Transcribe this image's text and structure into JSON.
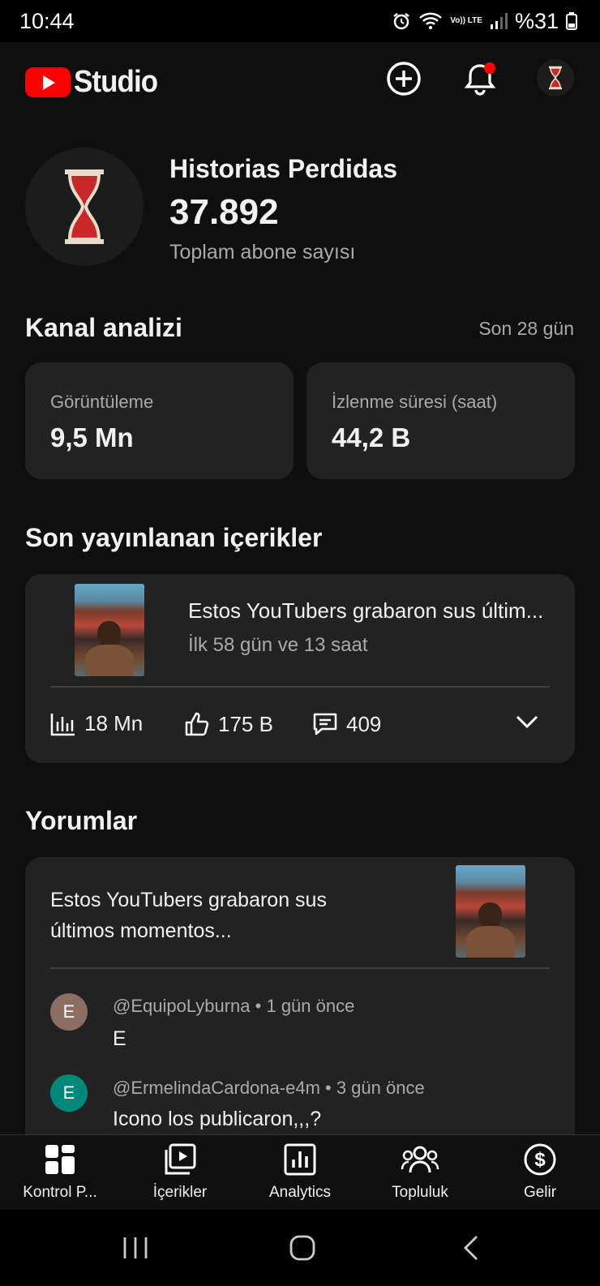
{
  "status_bar": {
    "time": "10:44",
    "network_label": "Vo)) LTE",
    "battery": "%31"
  },
  "app": {
    "logo_text": "Studio"
  },
  "channel": {
    "name": "Historias Perdidas",
    "subscribers": "37.892",
    "subscribers_label": "Toplam abone sayısı"
  },
  "analytics": {
    "title": "Kanal analizi",
    "period": "Son 28 gün",
    "cards": [
      {
        "label": "Görüntüleme",
        "value": "9,5 Mn"
      },
      {
        "label": "İzlenme süresi (saat)",
        "value": "44,2 B"
      }
    ]
  },
  "recent": {
    "title": "Son yayınlanan içerikler",
    "video_title": "Estos YouTubers grabaron sus últim...",
    "age": "İlk 58 gün ve 13 saat",
    "views": "18 Mn",
    "likes": "175 B",
    "comments": "409"
  },
  "comments_section": {
    "title": "Yorumlar",
    "video_title_line1": "Estos YouTubers grabaron sus",
    "video_title_line2": "últimos momentos...",
    "items": [
      {
        "initial": "E",
        "author": "@EquipoLyburna",
        "time": "1 gün önce",
        "text": "E",
        "avatar_color": "#8d6e63"
      },
      {
        "initial": "E",
        "author": "@ErmelindaCardona-e4m",
        "time": "3 gün önce",
        "text": "Icono los publicaron,,,?",
        "avatar_color": "#00897b"
      }
    ]
  },
  "nav": [
    {
      "label": "Kontrol P...",
      "icon": "dashboard-icon"
    },
    {
      "label": "İçerikler",
      "icon": "content-icon"
    },
    {
      "label": "Analytics",
      "icon": "analytics-icon"
    },
    {
      "label": "Topluluk",
      "icon": "community-icon"
    },
    {
      "label": "Gelir",
      "icon": "earn-icon"
    }
  ],
  "colors": {
    "background": "#0f0f0f",
    "card": "#222222",
    "brand_red": "#ff0000",
    "secondary_text": "#aaaaaa"
  }
}
